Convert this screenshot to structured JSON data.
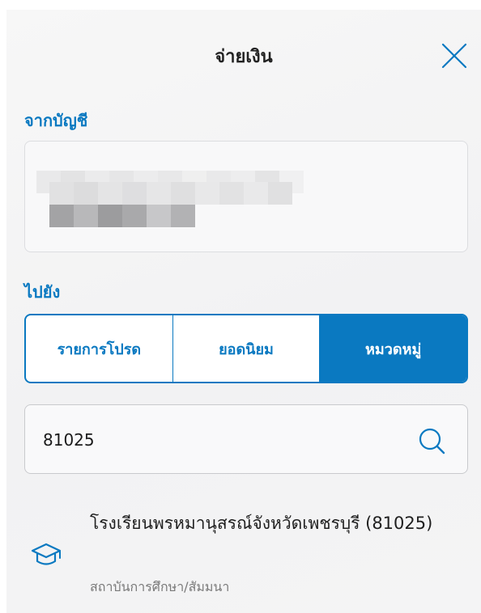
{
  "header": {
    "title": "จ่ายเงิน"
  },
  "from_section": {
    "label": "จากบัญชี"
  },
  "to_section": {
    "label": "ไปยัง",
    "tabs": [
      {
        "label": "รายการโปรด",
        "active": false
      },
      {
        "label": "ยอดนิยม",
        "active": false
      },
      {
        "label": "หมวดหมู่",
        "active": true
      }
    ]
  },
  "search": {
    "value": "81025",
    "placeholder": ""
  },
  "results": [
    {
      "name": "โรงเรียนพรหมานุสรณ์จังหวัดเพชรบุรี (81025)",
      "category": "สถาบันการศึกษา/สัมมนา",
      "icon": "graduation-cap-icon"
    }
  ],
  "colors": {
    "accent": "#0a79c1",
    "background": "#f4f4f5",
    "border": "#c9cacd",
    "secondary_text": "#7a7a7a"
  }
}
